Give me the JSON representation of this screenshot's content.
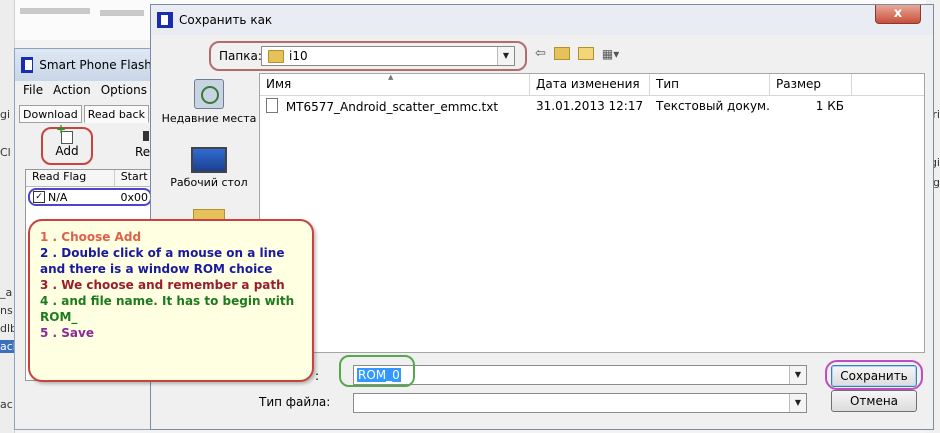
{
  "background": {
    "left_fragments": [
      "gi",
      "Cl",
      "_a",
      "ns",
      "dlb",
      "acl",
      "ac"
    ],
    "right_fragments": [
      "ri",
      "gi",
      "pg"
    ]
  },
  "flash_tool": {
    "title": "Smart Phone Flash T",
    "menu": [
      "File",
      "Action",
      "Options"
    ],
    "tabs": [
      "Download",
      "Read back"
    ],
    "add_label": "Add",
    "remove_label": "Re",
    "columns": [
      "Read Flag",
      "Start"
    ],
    "row": {
      "checked": true,
      "flag": "N/A",
      "start": "0x00"
    }
  },
  "dialog": {
    "title": "Сохранить как",
    "close_glyph": "x",
    "look_in_label": "Папка:",
    "look_in_value": "i10",
    "places": [
      {
        "label": "Недавние места",
        "icon": "recent-places-icon"
      },
      {
        "label": "Рабочий стол",
        "icon": "desktop-icon"
      },
      {
        "label": "",
        "icon": "libraries-folder-icon"
      }
    ],
    "columns": [
      "Имя",
      "Дата изменения",
      "Тип",
      "Размер"
    ],
    "files": [
      {
        "name": "MT6577_Android_scatter_emmc.txt",
        "modified": "31.01.2013 12:17",
        "type": "Текстовый докум...",
        "size": "1 КБ"
      }
    ],
    "filename_label": ":",
    "filename_value": "ROM_0",
    "filetype_label": "Тип файла:",
    "filetype_value": "",
    "save_button": "Сохранить",
    "cancel_button": "Отмена"
  },
  "annotation": {
    "lines": [
      {
        "text": "1 . Choose Add",
        "color": "#e0604a"
      },
      {
        "text": "2 . Double click of a mouse on a line and there is a window ROM choice",
        "color": "#1a1aa0"
      },
      {
        "text": "3 . We choose and remember a path",
        "color": "#9a1d2d"
      },
      {
        "text": "4 . and file name. It has to begin with ROM_",
        "color": "#1f7a1f"
      },
      {
        "text": "5 . Save",
        "color": "#8a2a9a"
      }
    ]
  }
}
